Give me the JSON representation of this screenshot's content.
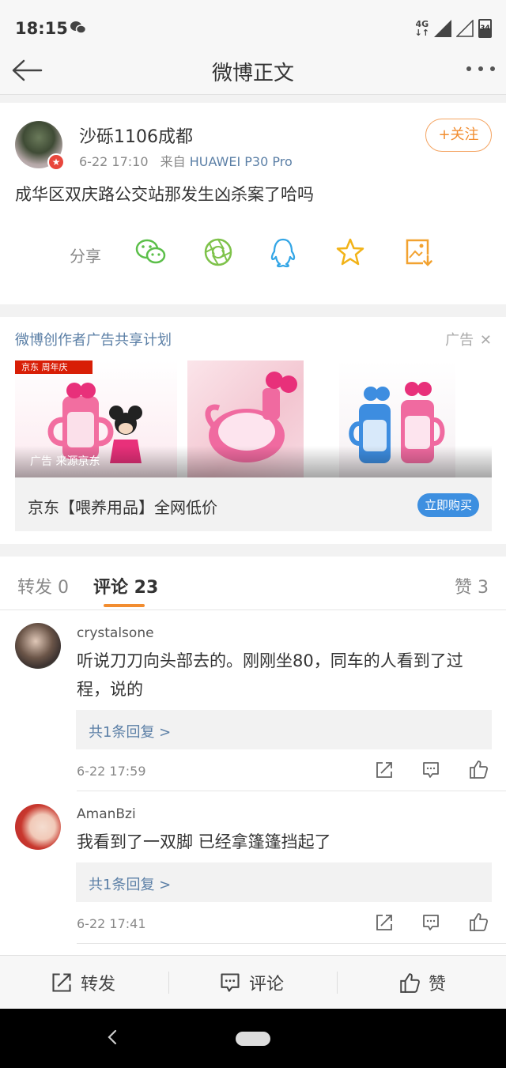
{
  "status_bar": {
    "time": "18:15",
    "network": "4G",
    "battery": "34",
    "chat_icon": "wechat-icon"
  },
  "nav": {
    "title": "微博正文",
    "back_icon": "arrow-left-icon",
    "more_icon": "more-dots-icon"
  },
  "post": {
    "username": "沙砾1106成都",
    "time": "6-22 17:10",
    "from_label": "来自",
    "device": "HUAWEI P30 Pro",
    "follow_label": "+关注",
    "text": "成华区双庆路公交站那发生凶杀案了哈吗",
    "share_label": "分享",
    "share_icons": [
      "wechat-icon",
      "moments-icon",
      "qq-icon",
      "favorite-star-icon",
      "save-image-icon"
    ]
  },
  "ad": {
    "header": "微博创作者广告共享计划",
    "tag": "广告",
    "jd_badge": "京东 周年庆",
    "source": "广告 来源京东",
    "text": "京东【喂养用品】全网低价",
    "button": "立即购买"
  },
  "tabs": {
    "repost": "转发 0",
    "comments": "评论 23",
    "likes": "赞 3"
  },
  "comments": [
    {
      "name": "crystalsone",
      "text": "听说刀刀向头部去的。刚刚坐80，同车的人看到了过程，说的",
      "reply": "共1条回复 >",
      "time": "6-22 17:59"
    },
    {
      "name": "AmanBzi",
      "text": "我看到了一双脚 已经拿篷篷挡起了",
      "reply": "共1条回复 >",
      "time": "6-22 17:41"
    }
  ],
  "actionbar": {
    "repost": "转发",
    "comment": "评论",
    "like": "赞"
  },
  "colors": {
    "accent": "#f28d30",
    "link": "#5b7fa6",
    "buy_button": "#3d8fe0"
  }
}
